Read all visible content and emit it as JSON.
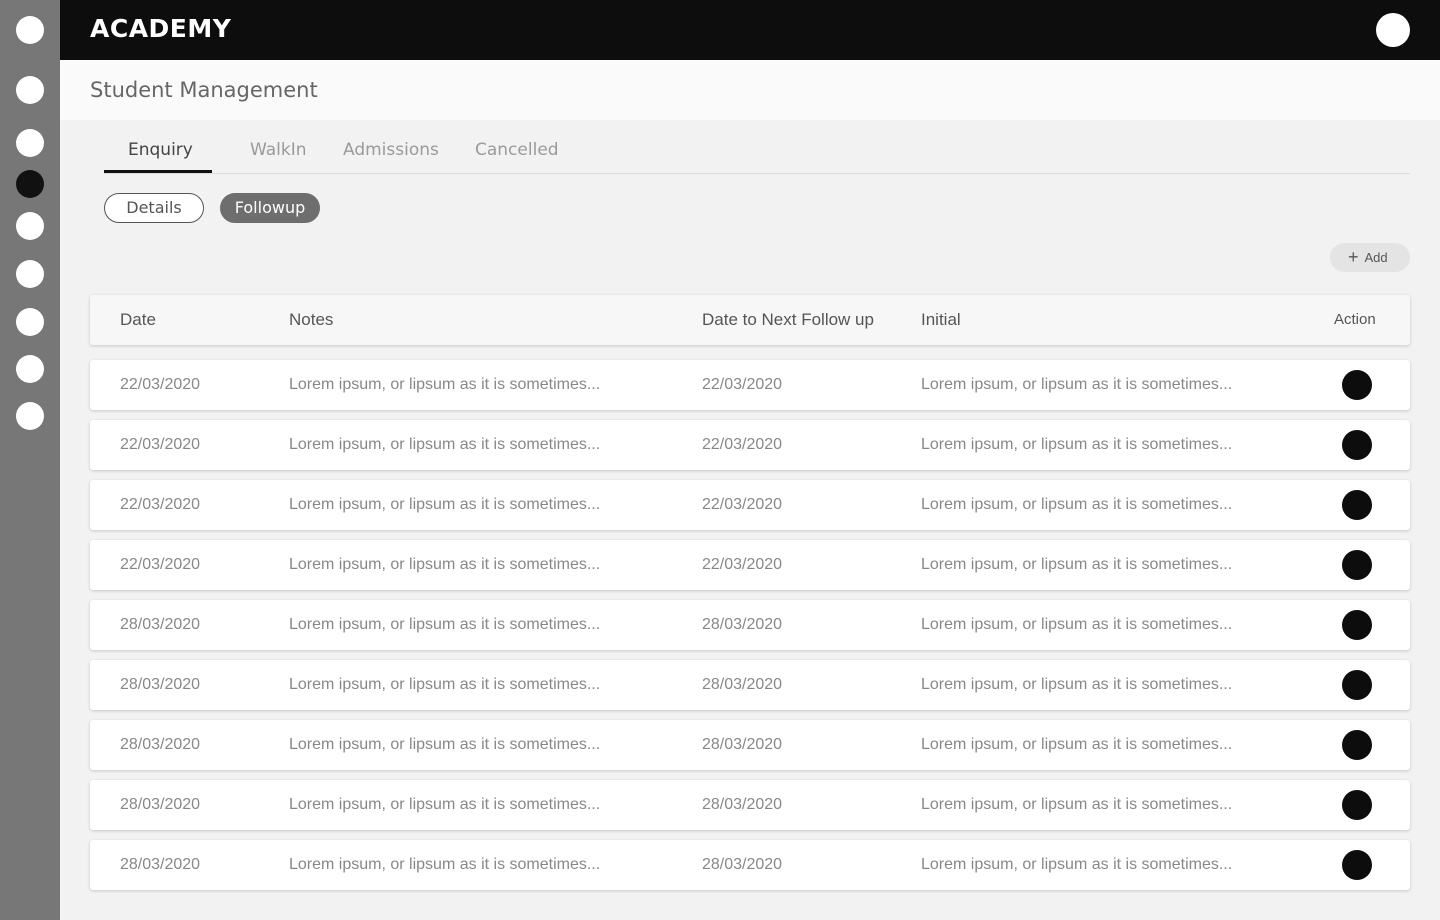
{
  "sidebar": {
    "items": [
      {
        "icon": "nav-circle-icon",
        "active": false
      },
      {
        "icon": "nav-circle-icon",
        "active": false
      },
      {
        "icon": "nav-circle-icon",
        "active": false
      },
      {
        "icon": "nav-circle-icon",
        "active": true
      },
      {
        "icon": "nav-circle-icon",
        "active": false
      },
      {
        "icon": "nav-circle-icon",
        "active": false
      },
      {
        "icon": "nav-circle-icon",
        "active": false
      },
      {
        "icon": "nav-circle-icon",
        "active": false
      },
      {
        "icon": "nav-circle-icon",
        "active": false
      }
    ]
  },
  "header": {
    "brand": "ACADEMY",
    "avatar_icon": "avatar-icon"
  },
  "page": {
    "title": "Student Management"
  },
  "tabs": [
    {
      "label": "Enquiry",
      "active": true
    },
    {
      "label": "WalkIn",
      "active": false
    },
    {
      "label": "Admissions",
      "active": false
    },
    {
      "label": "Cancelled",
      "active": false
    }
  ],
  "subtabs": {
    "details": "Details",
    "followup": "Followup"
  },
  "toolbar": {
    "add_label": "Add",
    "add_icon": "plus-icon"
  },
  "table": {
    "columns": [
      "Date",
      "Notes",
      "Date to Next Follow up",
      "Initial",
      "Action"
    ],
    "rows": [
      [
        "22/03/2020",
        "Lorem ipsum, or lipsum as it is sometimes...",
        "22/03/2020",
        "Lorem ipsum, or lipsum as it is sometimes..."
      ],
      [
        "22/03/2020",
        "Lorem ipsum, or lipsum as it is sometimes...",
        "22/03/2020",
        "Lorem ipsum, or lipsum as it is sometimes..."
      ],
      [
        "22/03/2020",
        "Lorem ipsum, or lipsum as it is sometimes...",
        "22/03/2020",
        "Lorem ipsum, or lipsum as it is sometimes..."
      ],
      [
        "22/03/2020",
        "Lorem ipsum, or lipsum as it is sometimes...",
        "22/03/2020",
        "Lorem ipsum, or lipsum as it is sometimes..."
      ],
      [
        "28/03/2020",
        "Lorem ipsum, or lipsum as it is sometimes...",
        "28/03/2020",
        "Lorem ipsum, or lipsum as it is sometimes..."
      ],
      [
        "28/03/2020",
        "Lorem ipsum, or lipsum as it is sometimes...",
        "28/03/2020",
        "Lorem ipsum, or lipsum as it is sometimes..."
      ],
      [
        "28/03/2020",
        "Lorem ipsum, or lipsum as it is sometimes...",
        "28/03/2020",
        "Lorem ipsum, or lipsum as it is sometimes..."
      ],
      [
        "28/03/2020",
        "Lorem ipsum, or lipsum as it is sometimes...",
        "28/03/2020",
        "Lorem ipsum, or lipsum as it is sometimes..."
      ],
      [
        "28/03/2020",
        "Lorem ipsum, or lipsum as it is sometimes...",
        "28/03/2020",
        "Lorem ipsum, or lipsum as it is sometimes..."
      ]
    ]
  },
  "colors": {
    "sidebar": "#777777",
    "topbar": "#0d0d0d",
    "accent": "#111111",
    "pill_active": "#6e6e6e"
  }
}
